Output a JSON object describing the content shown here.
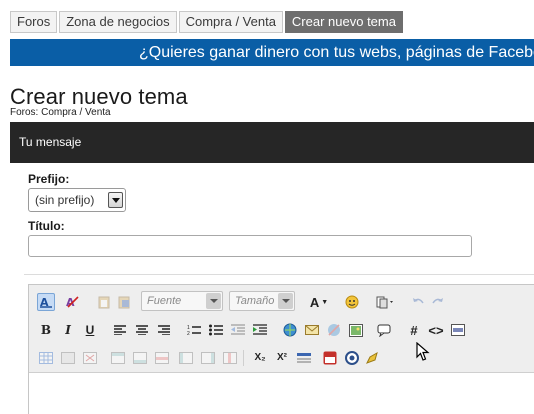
{
  "breadcrumbs": [
    "Foros",
    "Zona de negocios",
    "Compra / Venta",
    "Crear nuevo tema"
  ],
  "banner": {
    "text": "¿Quieres ganar dinero con tus webs, páginas de Facebook"
  },
  "page": {
    "title": "Crear nuevo tema",
    "path": "Foros: Compra / Venta"
  },
  "message_bar": {
    "label": "Tu mensaje"
  },
  "form": {
    "prefix_label": "Prefijo:",
    "prefix_value": "(sin prefijo)",
    "title_label": "Título:",
    "title_value": ""
  },
  "editor": {
    "font_placeholder": "Fuente",
    "size_placeholder": "Tamaño",
    "bold": "B",
    "italic": "I",
    "underline": "U",
    "hash": "#",
    "code": "<>",
    "subscript": "X₂",
    "superscript": "X²",
    "text_color": "A"
  }
}
